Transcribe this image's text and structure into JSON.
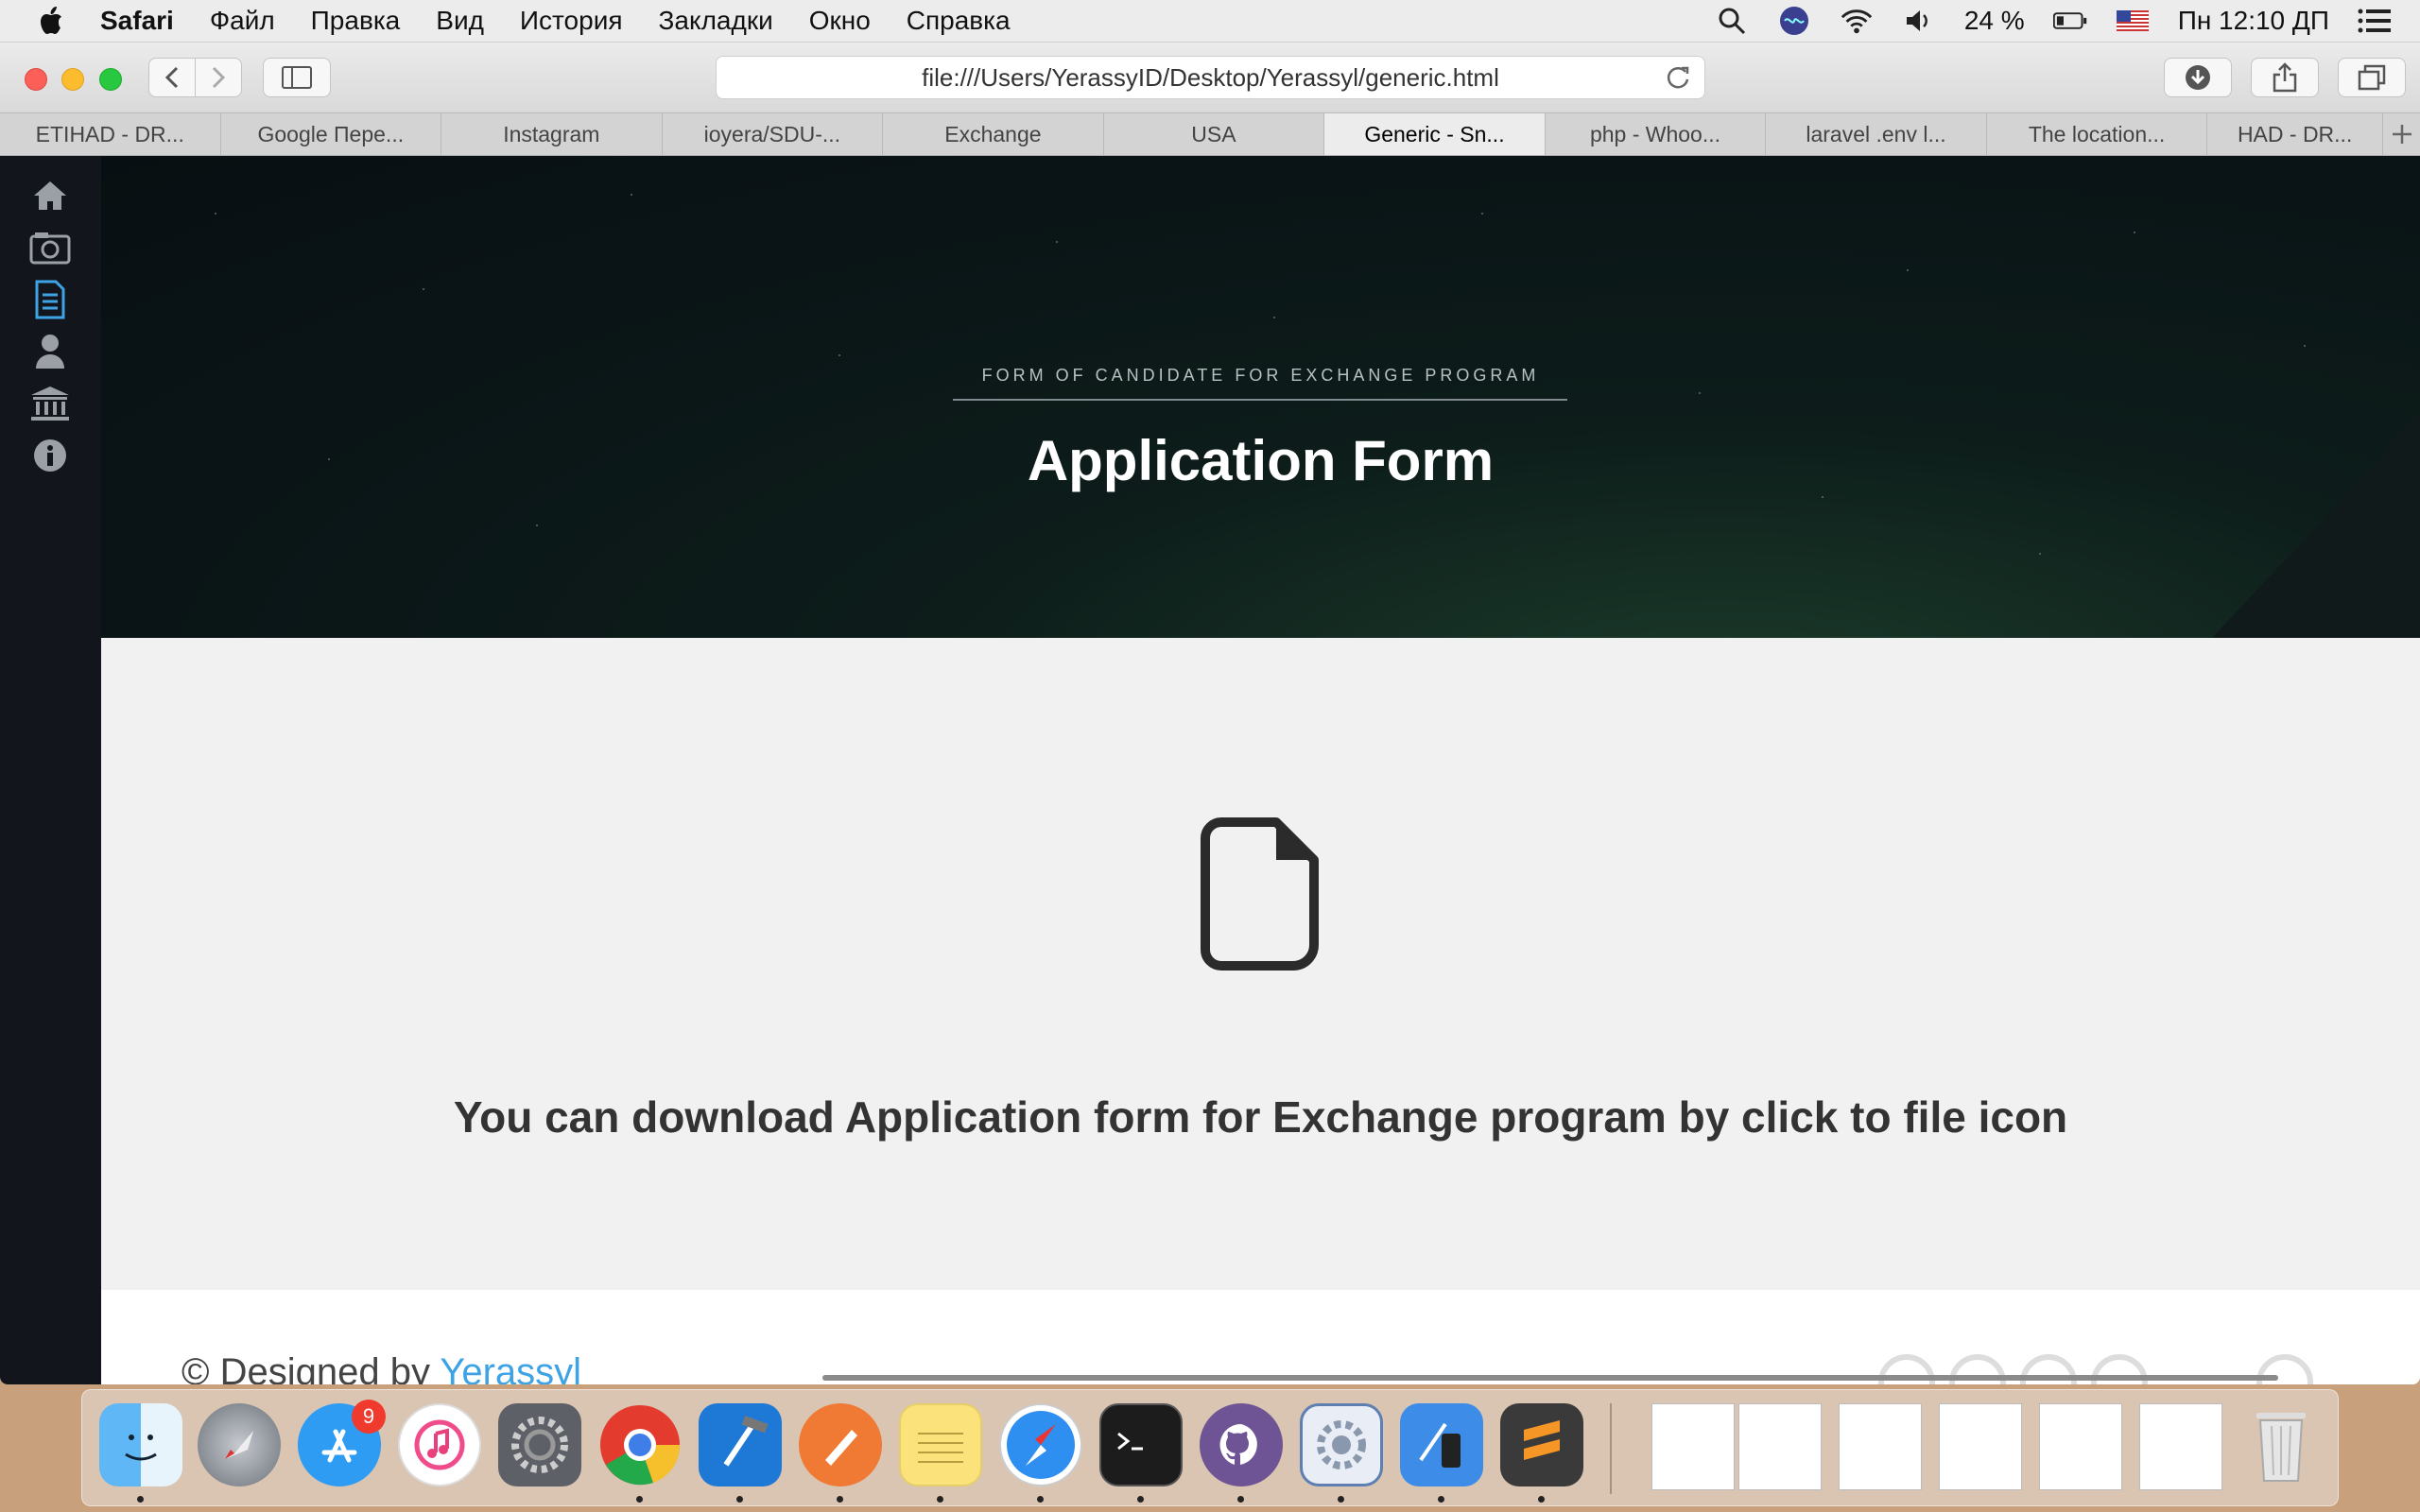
{
  "menubar": {
    "app_name": "Safari",
    "items": [
      "Файл",
      "Правка",
      "Вид",
      "История",
      "Закладки",
      "Окно",
      "Справка"
    ],
    "battery_percent": "24 %",
    "clock": "Пн 12:10 ДП"
  },
  "browser": {
    "url": "file:///Users/YerassyID/Desktop/Yerassyl/generic.html",
    "tabs": [
      {
        "label": "ETIHAD - DR..."
      },
      {
        "label": "Google Пере..."
      },
      {
        "label": "Instagram"
      },
      {
        "label": "ioyera/SDU-..."
      },
      {
        "label": "Exchange"
      },
      {
        "label": "USA"
      },
      {
        "label": "Generic - Sn..."
      },
      {
        "label": "php - Whoo..."
      },
      {
        "label": "laravel .env l..."
      },
      {
        "label": "The location..."
      },
      {
        "label": "HAD - DR..."
      }
    ],
    "active_tab_index": 6
  },
  "page": {
    "sidebar": [
      "home-icon",
      "camera-icon",
      "document-icon",
      "user-icon",
      "bank-icon",
      "info-icon"
    ],
    "banner": {
      "subtitle": "FORM OF CANDIDATE FOR EXCHANGE PROGRAM",
      "title": "Application Form"
    },
    "main": {
      "download_text": "You can download Application form for Exchange program by click to file icon"
    },
    "footer": {
      "text_prefix": "© Designed by",
      "link": "Yerassyl"
    }
  },
  "dock": {
    "app_store_badge": "9"
  },
  "colors": {
    "accent_blue": "#3ea3e5",
    "sidebar_bg": "#12161c",
    "main_bg": "#f1f1f1"
  }
}
